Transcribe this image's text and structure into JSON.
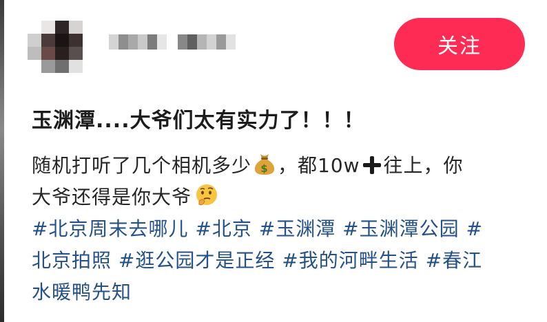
{
  "header": {
    "follow_label": "关注"
  },
  "post": {
    "title": "玉渊潭....大爷们太有实力了！！！",
    "body": {
      "line1_a": "随机打听了几个相机多少",
      "line1_b": "，都10w",
      "line1_c": "往上，你",
      "line2_a": "大爷还得是你大爷"
    },
    "icons": {
      "money": "money-bag-icon",
      "plus": "heavy-plus-icon",
      "thinking": "thinking-face-icon"
    },
    "hashtags": {
      "line1": [
        "#北京周末去哪儿",
        "#北京",
        "#玉渊潭",
        "#玉渊潭公园",
        "#"
      ],
      "line2": [
        "北京拍照",
        "#逛公园才是正经",
        "#我的河畔生活",
        "#春江"
      ],
      "line3": [
        "水暖鸭先知"
      ]
    }
  },
  "colors": {
    "follow_button": "#fe2c55",
    "hashtag": "#24518a",
    "title": "#1c1c1c"
  }
}
